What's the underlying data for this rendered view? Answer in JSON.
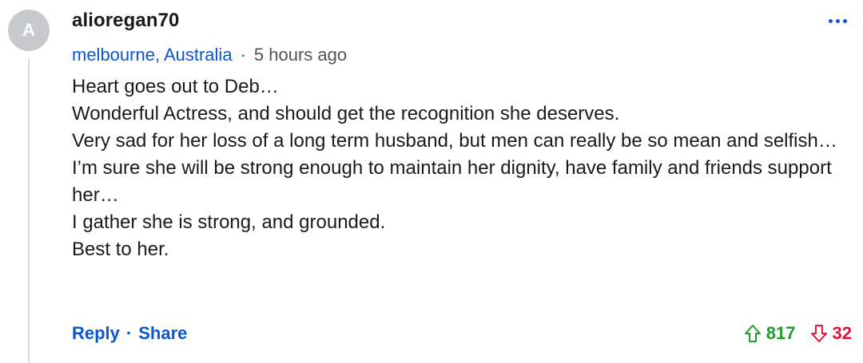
{
  "comment": {
    "avatar_initial": "A",
    "username": "alioregan70",
    "location": "melbourne, Australia",
    "separator": "·",
    "timestamp": "5 hours ago",
    "lines": [
      "Heart goes out to Deb…",
      "Wonderful Actress, and should get the recognition she deserves.",
      "Very sad for her loss of a long term husband, but men can really be so mean and selfish…",
      "I’m sure she will be strong enough to maintain her dignity, have family and friends support her…",
      "I gather she is strong, and grounded.",
      "Best to her."
    ],
    "actions": {
      "reply_label": "Reply",
      "separator": "·",
      "share_label": "Share"
    },
    "votes": {
      "up_count": "817",
      "down_count": "32"
    },
    "more_icon": "ellipsis-icon"
  },
  "colors": {
    "link": "#0b57d0",
    "upvote": "#1f9e2a",
    "downvote": "#e0173c",
    "avatar_bg": "#c7c9cc"
  }
}
